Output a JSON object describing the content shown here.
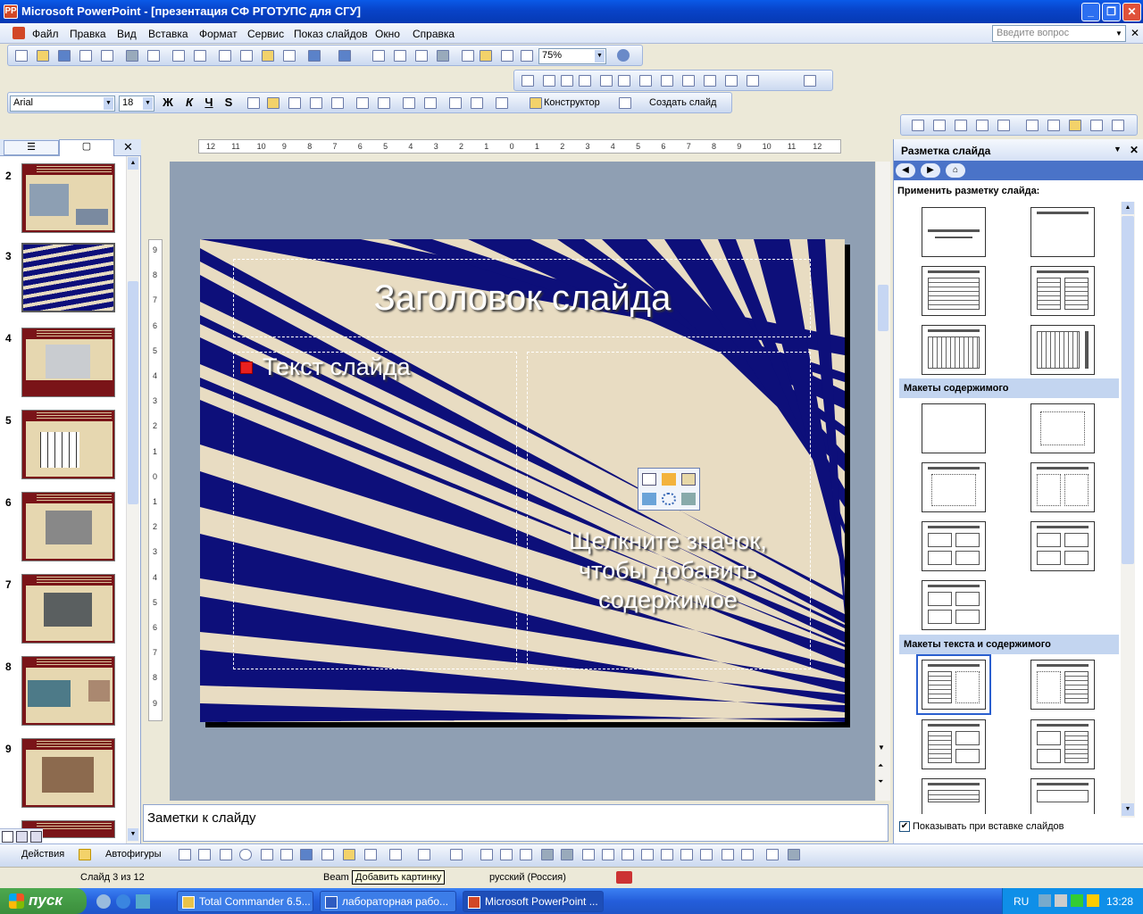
{
  "window": {
    "title": "Microsoft PowerPoint - [презентация СФ РГОТУПС для СГУ]",
    "app_icon": "PP"
  },
  "menu": {
    "items": [
      "Файл",
      "Правка",
      "Вид",
      "Вставка",
      "Формат",
      "Сервис",
      "Показ слайдов",
      "Окно",
      "Справка"
    ],
    "ask_placeholder": "Введите вопрос"
  },
  "toolbar": {
    "zoom": "75%",
    "font": "Arial",
    "font_size": "18",
    "designer_label": "Конструктор",
    "new_slide_label": "Создать слайд",
    "bold": "Ж",
    "italic": "К",
    "underline": "Ч",
    "shadow": "S"
  },
  "thumbnails": {
    "numbers": [
      "2",
      "3",
      "4",
      "5",
      "6",
      "7",
      "8",
      "9"
    ],
    "selected": "3"
  },
  "ruler": {
    "h": [
      "12",
      "11",
      "10",
      "9",
      "8",
      "7",
      "6",
      "5",
      "4",
      "3",
      "2",
      "1",
      "0",
      "1",
      "2",
      "3",
      "4",
      "5",
      "6",
      "7",
      "8",
      "9",
      "10",
      "11",
      "12"
    ],
    "v": [
      "9",
      "8",
      "7",
      "6",
      "5",
      "4",
      "3",
      "2",
      "1",
      "0",
      "1",
      "2",
      "3",
      "4",
      "5",
      "6",
      "7",
      "8",
      "9"
    ]
  },
  "slide": {
    "title": "Заголовок слайда",
    "body": "Текст слайда",
    "content_hint": "Щелкните значок, чтобы добавить содержимое"
  },
  "notes": {
    "placeholder": "Заметки к слайду"
  },
  "taskpane": {
    "title": "Разметка слайда",
    "apply_label": "Применить разметку слайда:",
    "section_content": "Макеты содержимого",
    "section_text_content": "Макеты текста и содержимого",
    "show_on_insert": "Показывать при вставке слайдов"
  },
  "drawbar": {
    "actions": "Действия",
    "autoshapes": "Автофигуры"
  },
  "status": {
    "slide": "Слайд 3 из 12",
    "design": "Beam",
    "tooltip": "Добавить картинку",
    "lang": "русский (Россия)"
  },
  "taskbar": {
    "start": "пуск",
    "tasks": [
      "Total Commander 6.5...",
      "лабораторная рабо...",
      "Microsoft PowerPoint ..."
    ],
    "lang": "RU",
    "clock": "13:28"
  },
  "colors": {
    "xp_blue": "#0843c8",
    "slide_navy": "#0d0f7a",
    "slide_parchment": "#e8dcc2",
    "start_green": "#3b8e3c"
  }
}
